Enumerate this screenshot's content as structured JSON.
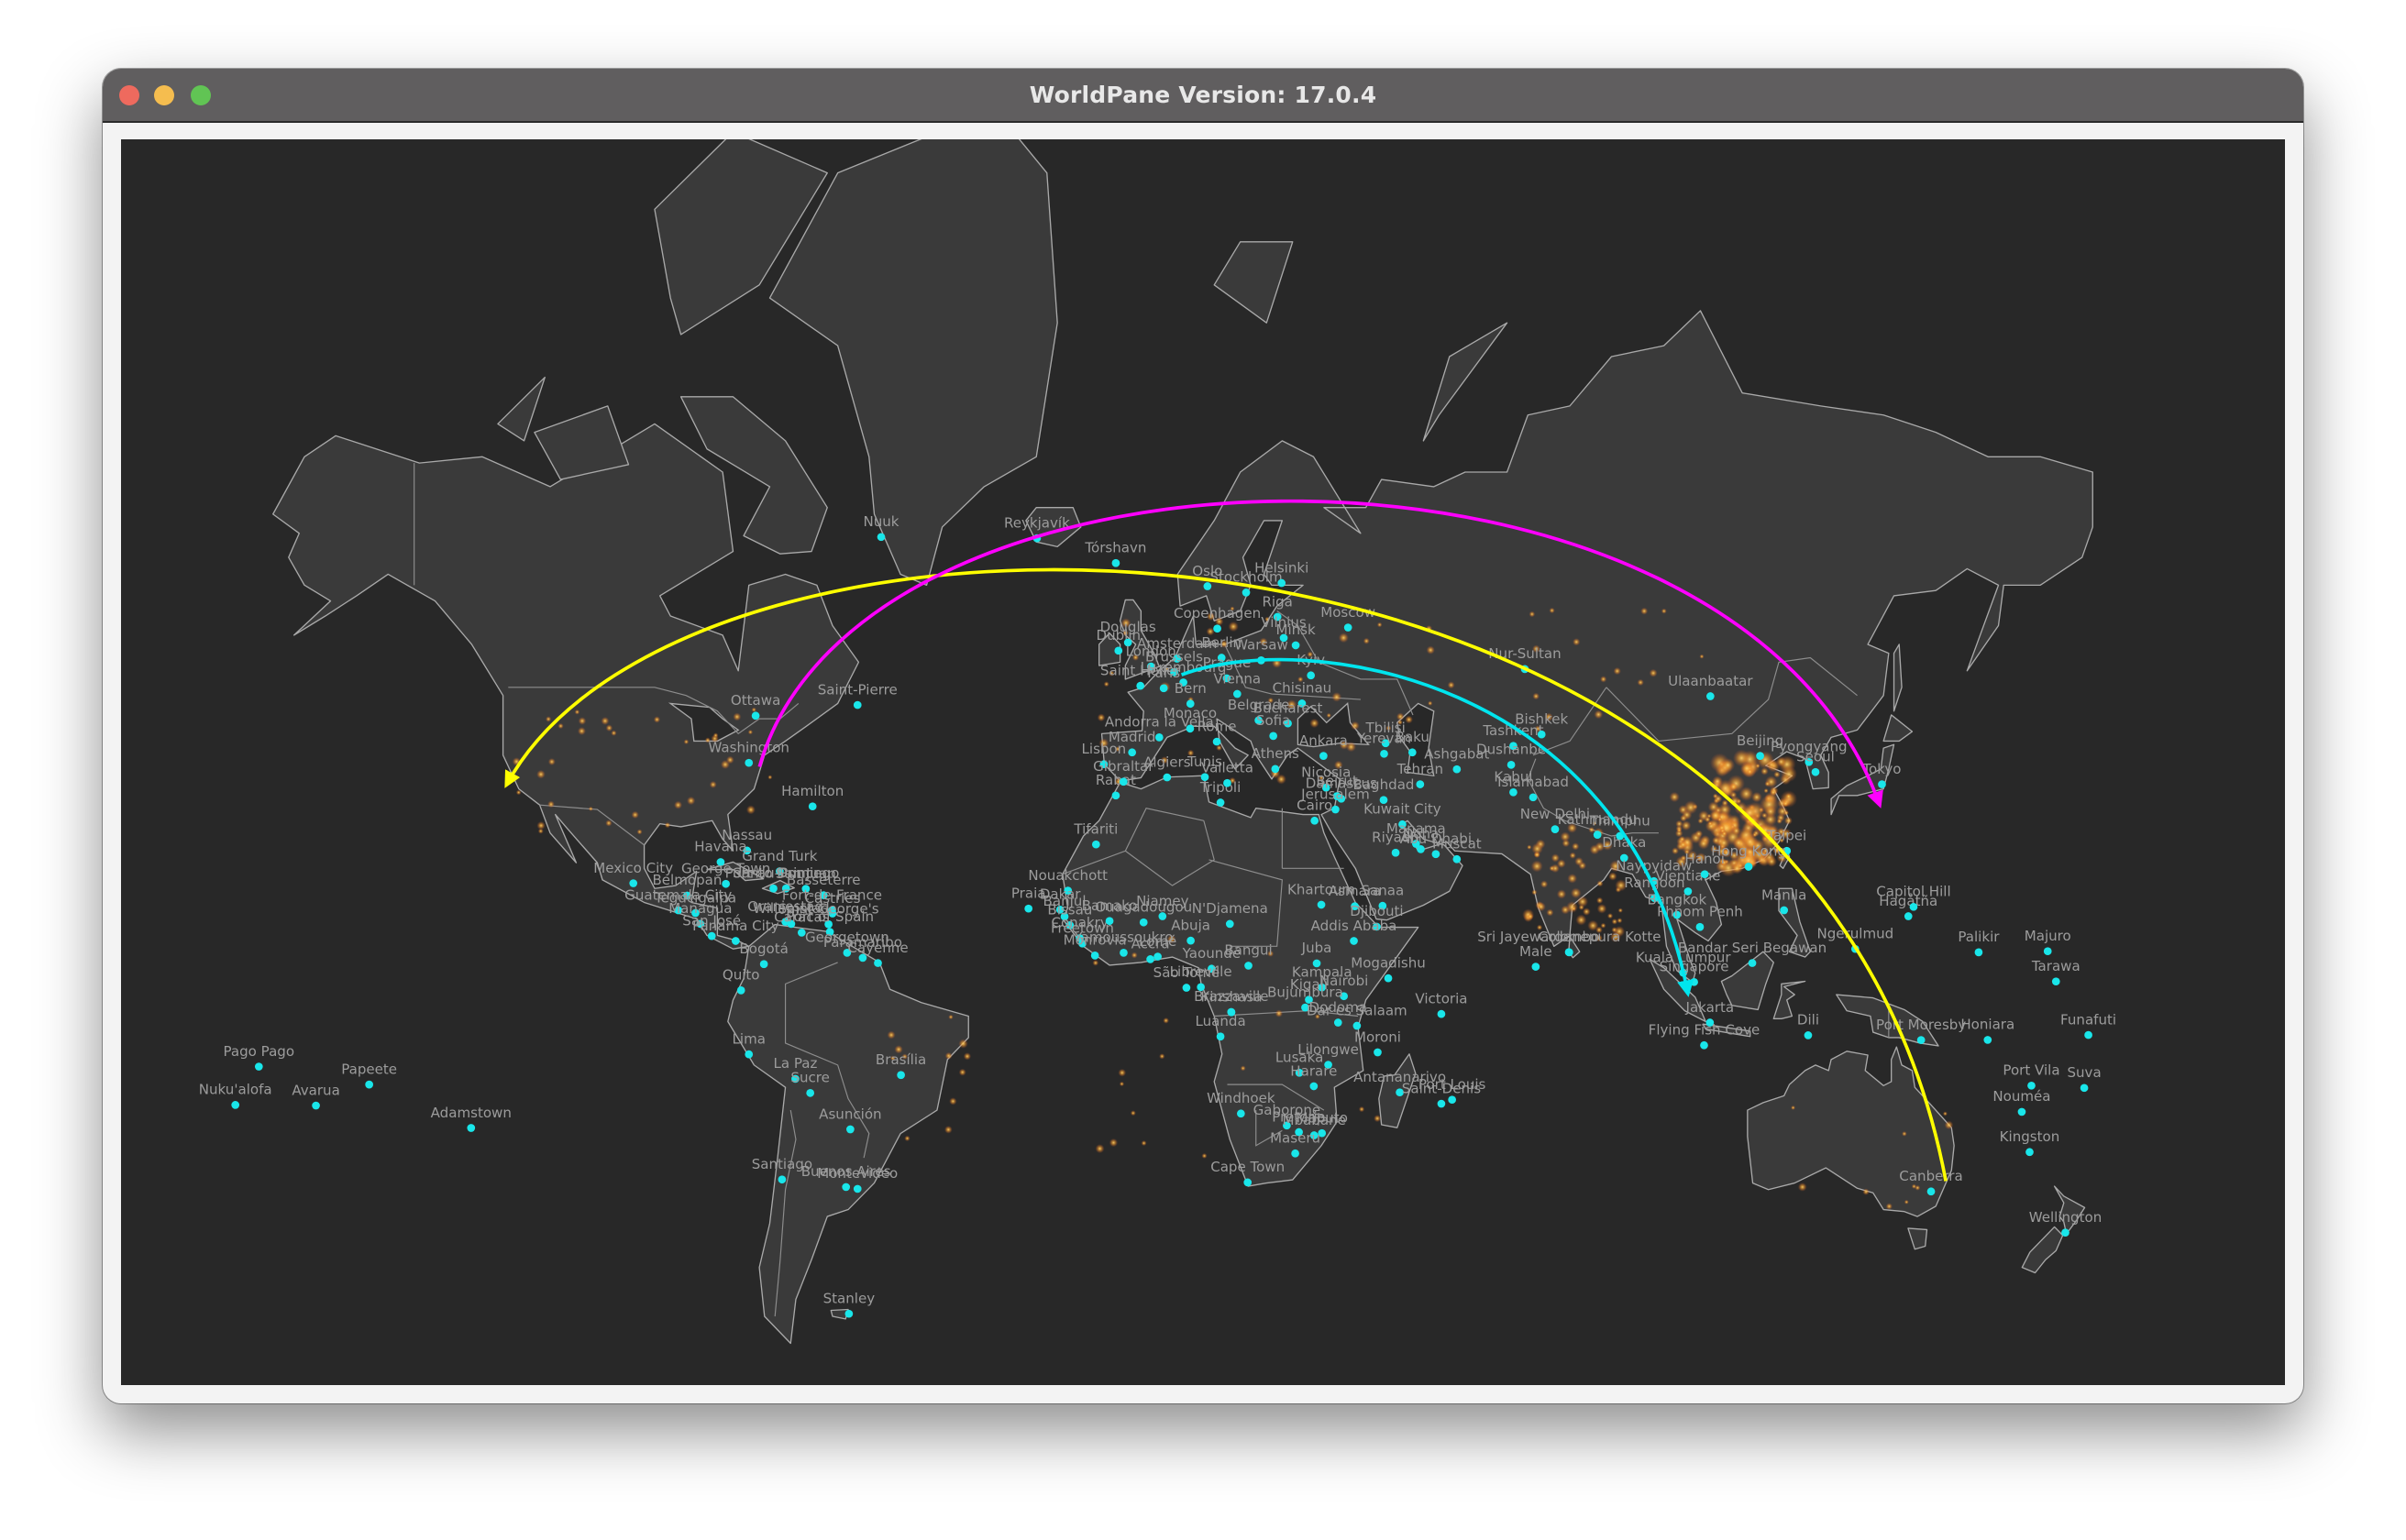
{
  "window": {
    "title": "WorldPane Version: 17.0.4",
    "controls": [
      "close",
      "minimize",
      "zoom"
    ]
  },
  "map": {
    "background_color": "#282828",
    "land_color": "#3a3a3a",
    "coastline_color": "#a9a9a9",
    "city_dot_color": "#19e6ea",
    "heat_color": "#f39a2c",
    "arcs": [
      {
        "color": "#ffff00",
        "arrow": "end"
      },
      {
        "color": "#ff00ff",
        "arrow": "end"
      },
      {
        "color": "#00e5ee",
        "arrow": "end"
      }
    ],
    "cities": [
      {
        "name": "Nuuk",
        "lon": -51.7,
        "lat": 64.2
      },
      {
        "name": "Reykjavík",
        "lon": -21.9,
        "lat": 64.1
      },
      {
        "name": "Tórshavn",
        "lon": -6.8,
        "lat": 62
      },
      {
        "name": "Oslo",
        "lon": 10.7,
        "lat": 59.9
      },
      {
        "name": "Stockholm",
        "lon": 18.1,
        "lat": 59.3
      },
      {
        "name": "Helsinki",
        "lon": 24.9,
        "lat": 60.2
      },
      {
        "name": "Copenhagen",
        "lon": 12.6,
        "lat": 55.7
      },
      {
        "name": "Moscow",
        "lon": 37.6,
        "lat": 55.8
      },
      {
        "name": "Riga",
        "lon": 24.1,
        "lat": 56.9
      },
      {
        "name": "Vilnius",
        "lon": 25.3,
        "lat": 54.7
      },
      {
        "name": "Minsk",
        "lon": 27.6,
        "lat": 53.9
      },
      {
        "name": "Warsaw",
        "lon": 21,
        "lat": 52.2
      },
      {
        "name": "Berlin",
        "lon": 13.4,
        "lat": 52.5
      },
      {
        "name": "Amsterdam",
        "lon": 4.9,
        "lat": 52.4
      },
      {
        "name": "Dublin",
        "lon": -6.3,
        "lat": 53.3
      },
      {
        "name": "Douglas",
        "lon": -4.5,
        "lat": 54.2
      },
      {
        "name": "London",
        "lon": -0.1,
        "lat": 51.5
      },
      {
        "name": "Paris",
        "lon": 2.35,
        "lat": 48.9
      },
      {
        "name": "Brussels",
        "lon": 4.35,
        "lat": 50.85
      },
      {
        "name": "Luxembourg",
        "lon": 6.1,
        "lat": 49.6
      },
      {
        "name": "Saint Helier",
        "lon": -2.1,
        "lat": 49.2
      },
      {
        "name": "Prague",
        "lon": 14.4,
        "lat": 50.1
      },
      {
        "name": "Vienna",
        "lon": 16.4,
        "lat": 48.2
      },
      {
        "name": "Kyiv",
        "lon": 30.5,
        "lat": 50.45
      },
      {
        "name": "Chisinau",
        "lon": 28.8,
        "lat": 47
      },
      {
        "name": "Bucharest",
        "lon": 26.1,
        "lat": 44.4
      },
      {
        "name": "Belgrade",
        "lon": 20.5,
        "lat": 44.8
      },
      {
        "name": "Madrid",
        "lon": -3.7,
        "lat": 40.4
      },
      {
        "name": "Lisbon",
        "lon": -9.1,
        "lat": 38.7
      },
      {
        "name": "Andorra la Vella",
        "lon": 1.5,
        "lat": 42.5
      },
      {
        "name": "Rome",
        "lon": 12.5,
        "lat": 41.9
      },
      {
        "name": "Monaco",
        "lon": 7.4,
        "lat": 43.7
      },
      {
        "name": "Bern",
        "lon": 7.45,
        "lat": 46.95
      },
      {
        "name": "Athens",
        "lon": 23.7,
        "lat": 38
      },
      {
        "name": "Sofia",
        "lon": 23.3,
        "lat": 42.7
      },
      {
        "name": "Ankara",
        "lon": 32.9,
        "lat": 39.9
      },
      {
        "name": "Tbilisi",
        "lon": 44.8,
        "lat": 41.7
      },
      {
        "name": "Yerevan",
        "lon": 44.5,
        "lat": 40.2
      },
      {
        "name": "Baku",
        "lon": 49.9,
        "lat": 40.4
      },
      {
        "name": "Nicosia",
        "lon": 33.4,
        "lat": 35.2
      },
      {
        "name": "Damascus",
        "lon": 36.3,
        "lat": 33.5
      },
      {
        "name": "Beirut",
        "lon": 35.5,
        "lat": 33.9
      },
      {
        "name": "Jerusalem",
        "lon": 35.2,
        "lat": 31.8
      },
      {
        "name": "Baghdad",
        "lon": 44.4,
        "lat": 33.3
      },
      {
        "name": "Tehran",
        "lon": 51.4,
        "lat": 35.7
      },
      {
        "name": "Ashgabat",
        "lon": 58.4,
        "lat": 37.95
      },
      {
        "name": "Tashkent",
        "lon": 69.2,
        "lat": 41.3
      },
      {
        "name": "Dushanbe",
        "lon": 68.8,
        "lat": 38.6
      },
      {
        "name": "Bishkek",
        "lon": 74.6,
        "lat": 42.9
      },
      {
        "name": "Nur-Sultan",
        "lon": 71.4,
        "lat": 51.2
      },
      {
        "name": "Kabul",
        "lon": 69.2,
        "lat": 34.5
      },
      {
        "name": "Islamabad",
        "lon": 73,
        "lat": 33.7
      },
      {
        "name": "New Delhi",
        "lon": 77.2,
        "lat": 28.6
      },
      {
        "name": "Kathmandu",
        "lon": 85.3,
        "lat": 27.7
      },
      {
        "name": "Thimphu",
        "lon": 89.6,
        "lat": 27.5
      },
      {
        "name": "Dhaka",
        "lon": 90.4,
        "lat": 23.8
      },
      {
        "name": "Naypyidaw",
        "lon": 96.1,
        "lat": 19.8
      },
      {
        "name": "Rangoon",
        "lon": 96.2,
        "lat": 16.8
      },
      {
        "name": "Bangkok",
        "lon": 100.5,
        "lat": 13.75
      },
      {
        "name": "Vientiane",
        "lon": 102.6,
        "lat": 17.97
      },
      {
        "name": "Hanoi",
        "lon": 105.8,
        "lat": 21
      },
      {
        "name": "Phnom Penh",
        "lon": 104.9,
        "lat": 11.55
      },
      {
        "name": "Kuala Lumpur",
        "lon": 101.7,
        "lat": 3.1
      },
      {
        "name": "Singapore",
        "lon": 103.8,
        "lat": 1.35
      },
      {
        "name": "Jakarta",
        "lon": 106.8,
        "lat": -6.2
      },
      {
        "name": "Bandar Seri Begawan",
        "lon": 114.9,
        "lat": 4.9
      },
      {
        "name": "Manila",
        "lon": 121,
        "lat": 14.6
      },
      {
        "name": "Sri Jayewardenepura Kotte",
        "lon": 79.9,
        "lat": 6.9
      },
      {
        "name": "Colombo",
        "lon": 79.85,
        "lat": 6.93
      },
      {
        "name": "Male",
        "lon": 73.5,
        "lat": 4.2
      },
      {
        "name": "Beijing",
        "lon": 116.4,
        "lat": 39.9
      },
      {
        "name": "Pyongyang",
        "lon": 125.75,
        "lat": 39
      },
      {
        "name": "Seoul",
        "lon": 127,
        "lat": 37.55
      },
      {
        "name": "Tokyo",
        "lon": 139.7,
        "lat": 35.7
      },
      {
        "name": "Ulaanbaatar",
        "lon": 106.9,
        "lat": 47.9
      },
      {
        "name": "Taipei",
        "lon": 121.5,
        "lat": 25
      },
      {
        "name": "Hong Kong",
        "lon": 114.2,
        "lat": 22.3
      },
      {
        "name": "Cairo",
        "lon": 31.2,
        "lat": 30
      },
      {
        "name": "Tripoli",
        "lon": 13.2,
        "lat": 32.9
      },
      {
        "name": "Tunis",
        "lon": 10.2,
        "lat": 36.8
      },
      {
        "name": "Algiers",
        "lon": 3,
        "lat": 36.75
      },
      {
        "name": "Valletta",
        "lon": 14.5,
        "lat": 35.9
      },
      {
        "name": "Rabat",
        "lon": -6.8,
        "lat": 34
      },
      {
        "name": "Gibraltar",
        "lon": -5.35,
        "lat": 36.1
      },
      {
        "name": "Tifariti",
        "lon": -10.6,
        "lat": 26.1
      },
      {
        "name": "Nouakchott",
        "lon": -15.98,
        "lat": 18.1
      },
      {
        "name": "Dakar",
        "lon": -17.45,
        "lat": 14.7
      },
      {
        "name": "Praia",
        "lon": -23.5,
        "lat": 14.9
      },
      {
        "name": "Banjul",
        "lon": -16.6,
        "lat": 13.45
      },
      {
        "name": "Bissau",
        "lon": -15.6,
        "lat": 11.85
      },
      {
        "name": "Conakry",
        "lon": -13.7,
        "lat": 9.5
      },
      {
        "name": "Bamako",
        "lon": -8,
        "lat": 12.65
      },
      {
        "name": "Ouagadougou",
        "lon": -1.5,
        "lat": 12.4
      },
      {
        "name": "Niamey",
        "lon": 2.1,
        "lat": 13.5
      },
      {
        "name": "N'Djamena",
        "lon": 15,
        "lat": 12.1
      },
      {
        "name": "Abuja",
        "lon": 7.5,
        "lat": 9.05
      },
      {
        "name": "Accra",
        "lon": -0.2,
        "lat": 5.6
      },
      {
        "name": "Lomé",
        "lon": 1.2,
        "lat": 6.1
      },
      {
        "name": "Freetown",
        "lon": -13.2,
        "lat": 8.5
      },
      {
        "name": "Monrovia",
        "lon": -10.8,
        "lat": 6.3
      },
      {
        "name": "Yamoussoukro",
        "lon": -5.3,
        "lat": 6.8
      },
      {
        "name": "Yaoundé",
        "lon": 11.5,
        "lat": 3.85
      },
      {
        "name": "Bangui",
        "lon": 18.55,
        "lat": 4.4
      },
      {
        "name": "São Tomé",
        "lon": 6.7,
        "lat": 0.3
      },
      {
        "name": "Libreville",
        "lon": 9.45,
        "lat": 0.4
      },
      {
        "name": "Khartoum",
        "lon": 32.5,
        "lat": 15.6
      },
      {
        "name": "Asmara",
        "lon": 38.9,
        "lat": 15.3
      },
      {
        "name": "Sanaa",
        "lon": 44.2,
        "lat": 15.4
      },
      {
        "name": "Djibouti",
        "lon": 43.1,
        "lat": 11.6
      },
      {
        "name": "Addis Ababa",
        "lon": 38.7,
        "lat": 9
      },
      {
        "name": "Juba",
        "lon": 31.6,
        "lat": 4.85
      },
      {
        "name": "Mogadishu",
        "lon": 45.3,
        "lat": 2.05
      },
      {
        "name": "Kampala",
        "lon": 32.6,
        "lat": 0.35
      },
      {
        "name": "Nairobi",
        "lon": 36.8,
        "lat": -1.3
      },
      {
        "name": "Kigali",
        "lon": 30.1,
        "lat": -1.95
      },
      {
        "name": "Bujumbura",
        "lon": 29.4,
        "lat": -3.4
      },
      {
        "name": "Kinshasa",
        "lon": 15.3,
        "lat": -4.3
      },
      {
        "name": "Brazzaville",
        "lon": 15.25,
        "lat": -4.25
      },
      {
        "name": "Dodoma",
        "lon": 35.7,
        "lat": -6.2
      },
      {
        "name": "Dar es Salaam",
        "lon": 39.3,
        "lat": -6.8
      },
      {
        "name": "Luanda",
        "lon": 13.2,
        "lat": -8.8
      },
      {
        "name": "Lusaka",
        "lon": 28.3,
        "lat": -15.4
      },
      {
        "name": "Lilongwe",
        "lon": 33.8,
        "lat": -13.95
      },
      {
        "name": "Harare",
        "lon": 31.05,
        "lat": -17.8
      },
      {
        "name": "Antananarivo",
        "lon": 47.5,
        "lat": -18.9
      },
      {
        "name": "Moroni",
        "lon": 43.25,
        "lat": -11.7
      },
      {
        "name": "Victoria",
        "lon": 55.45,
        "lat": -4.6
      },
      {
        "name": "Port Louis",
        "lon": 57.5,
        "lat": -20.2
      },
      {
        "name": "Saint-Denis",
        "lon": 55.45,
        "lat": -20.9
      },
      {
        "name": "Windhoek",
        "lon": 17.1,
        "lat": -22.6
      },
      {
        "name": "Gaborone",
        "lon": 25.9,
        "lat": -24.65
      },
      {
        "name": "Pretoria",
        "lon": 28.2,
        "lat": -25.75
      },
      {
        "name": "Maputo",
        "lon": 32.6,
        "lat": -25.95
      },
      {
        "name": "Mbabane",
        "lon": 31.1,
        "lat": -26.3
      },
      {
        "name": "Maseru",
        "lon": 27.5,
        "lat": -29.3
      },
      {
        "name": "Cape Town",
        "lon": 18.4,
        "lat": -33.9
      },
      {
        "name": "Riyadh",
        "lon": 46.7,
        "lat": 24.7
      },
      {
        "name": "Kuwait City",
        "lon": 47.98,
        "lat": 29.4
      },
      {
        "name": "Manama",
        "lon": 50.6,
        "lat": 26.2
      },
      {
        "name": "Doha",
        "lon": 51.5,
        "lat": 25.3
      },
      {
        "name": "Abu Dhabi",
        "lon": 54.4,
        "lat": 24.45
      },
      {
        "name": "Muscat",
        "lon": 58.4,
        "lat": 23.6
      },
      {
        "name": "Ottawa",
        "lon": -75.7,
        "lat": 45.4
      },
      {
        "name": "Washington",
        "lon": -77,
        "lat": 38.9
      },
      {
        "name": "Saint-Pierre",
        "lon": -56.2,
        "lat": 46.8
      },
      {
        "name": "Hamilton",
        "lon": -64.8,
        "lat": 32.3
      },
      {
        "name": "Nassau",
        "lon": -77.35,
        "lat": 25.05
      },
      {
        "name": "Havana",
        "lon": -82.4,
        "lat": 23.1
      },
      {
        "name": "Grand Turk",
        "lon": -71.1,
        "lat": 21.5
      },
      {
        "name": "Mexico City",
        "lon": -99.1,
        "lat": 19.4
      },
      {
        "name": "George Town",
        "lon": -81.4,
        "lat": 19.3
      },
      {
        "name": "Belmopan",
        "lon": -88.8,
        "lat": 17.25
      },
      {
        "name": "Guatemala City",
        "lon": -90.5,
        "lat": 14.6
      },
      {
        "name": "Tegucigalpa",
        "lon": -87.2,
        "lat": 14.1
      },
      {
        "name": "Managua",
        "lon": -86.25,
        "lat": 12.1
      },
      {
        "name": "San José",
        "lon": -84.1,
        "lat": 9.9
      },
      {
        "name": "Panama City",
        "lon": -79.5,
        "lat": 9
      },
      {
        "name": "Port-au-Prince",
        "lon": -72.3,
        "lat": 18.5
      },
      {
        "name": "Santo Domingo",
        "lon": -69.9,
        "lat": 18.5
      },
      {
        "name": "San Juan",
        "lon": -66.1,
        "lat": 18.45
      },
      {
        "name": "Basseterre",
        "lon": -62.7,
        "lat": 17.3
      },
      {
        "name": "Fort-de-France",
        "lon": -61.07,
        "lat": 14.6
      },
      {
        "name": "Castries",
        "lon": -61,
        "lat": 14
      },
      {
        "name": "Oranjestad",
        "lon": -70,
        "lat": 12.5
      },
      {
        "name": "Willemstad",
        "lon": -68.9,
        "lat": 12.1
      },
      {
        "name": "Saint George's",
        "lon": -61.75,
        "lat": 12.05
      },
      {
        "name": "Port of Spain",
        "lon": -61.5,
        "lat": 10.65
      },
      {
        "name": "Caracas",
        "lon": -66.9,
        "lat": 10.5
      },
      {
        "name": "Bogotá",
        "lon": -74.1,
        "lat": 4.7
      },
      {
        "name": "Quito",
        "lon": -78.5,
        "lat": -0.2
      },
      {
        "name": "Georgetown",
        "lon": -58.2,
        "lat": 6.8
      },
      {
        "name": "Paramaribo",
        "lon": -55.2,
        "lat": 5.85
      },
      {
        "name": "Cayenne",
        "lon": -52.3,
        "lat": 4.9
      },
      {
        "name": "Lima",
        "lon": -77,
        "lat": -12.05
      },
      {
        "name": "La Paz",
        "lon": -68.1,
        "lat": -16.5
      },
      {
        "name": "Sucre",
        "lon": -65.26,
        "lat": -19
      },
      {
        "name": "Brasília",
        "lon": -47.9,
        "lat": -15.8
      },
      {
        "name": "Asunción",
        "lon": -57.6,
        "lat": -25.3
      },
      {
        "name": "Santiago",
        "lon": -70.65,
        "lat": -33.45
      },
      {
        "name": "Buenos Aires",
        "lon": -58.4,
        "lat": -34.6
      },
      {
        "name": "Montevideo",
        "lon": -56.2,
        "lat": -34.9
      },
      {
        "name": "Stanley",
        "lon": -57.85,
        "lat": -51.7
      },
      {
        "name": "Pago Pago",
        "lon": -170.7,
        "lat": -14.3
      },
      {
        "name": "Nuku'alofa",
        "lon": -175.2,
        "lat": -21.1
      },
      {
        "name": "Papeete",
        "lon": -149.6,
        "lat": -17.5
      },
      {
        "name": "Avarua",
        "lon": -159.8,
        "lat": -21.2
      },
      {
        "name": "Adamstown",
        "lon": -130.1,
        "lat": -25.07
      },
      {
        "name": "Palikir",
        "lon": 158.2,
        "lat": 6.9
      },
      {
        "name": "Majuro",
        "lon": 171.4,
        "lat": 7.1
      },
      {
        "name": "Tarawa",
        "lon": 173,
        "lat": 1.45
      },
      {
        "name": "Funafuti",
        "lon": 179.2,
        "lat": -8.5
      },
      {
        "name": "Port Vila",
        "lon": 168.3,
        "lat": -17.7
      },
      {
        "name": "Suva",
        "lon": 178.4,
        "lat": -18.1
      },
      {
        "name": "Nouméa",
        "lon": 166.45,
        "lat": -22.3
      },
      {
        "name": "Kingston",
        "lon": 167.95,
        "lat": -29.05
      },
      {
        "name": "Wellington",
        "lon": 174.8,
        "lat": -41.3
      },
      {
        "name": "Canberra",
        "lon": 149.1,
        "lat": -35.3
      },
      {
        "name": "Honiara",
        "lon": 159.95,
        "lat": -9.4
      },
      {
        "name": "Port Moresby",
        "lon": 147.2,
        "lat": -9.45
      },
      {
        "name": "Dili",
        "lon": 125.6,
        "lat": -8.55
      },
      {
        "name": "Ngerulmud",
        "lon": 134.6,
        "lat": 7.5
      },
      {
        "name": "Hagåtña",
        "lon": 144.75,
        "lat": 13.5
      },
      {
        "name": "Capitol Hill",
        "lon": 145.75,
        "lat": 15.2
      },
      {
        "name": "Flying Fish Cove",
        "lon": 105.7,
        "lat": -10.4
      }
    ]
  }
}
